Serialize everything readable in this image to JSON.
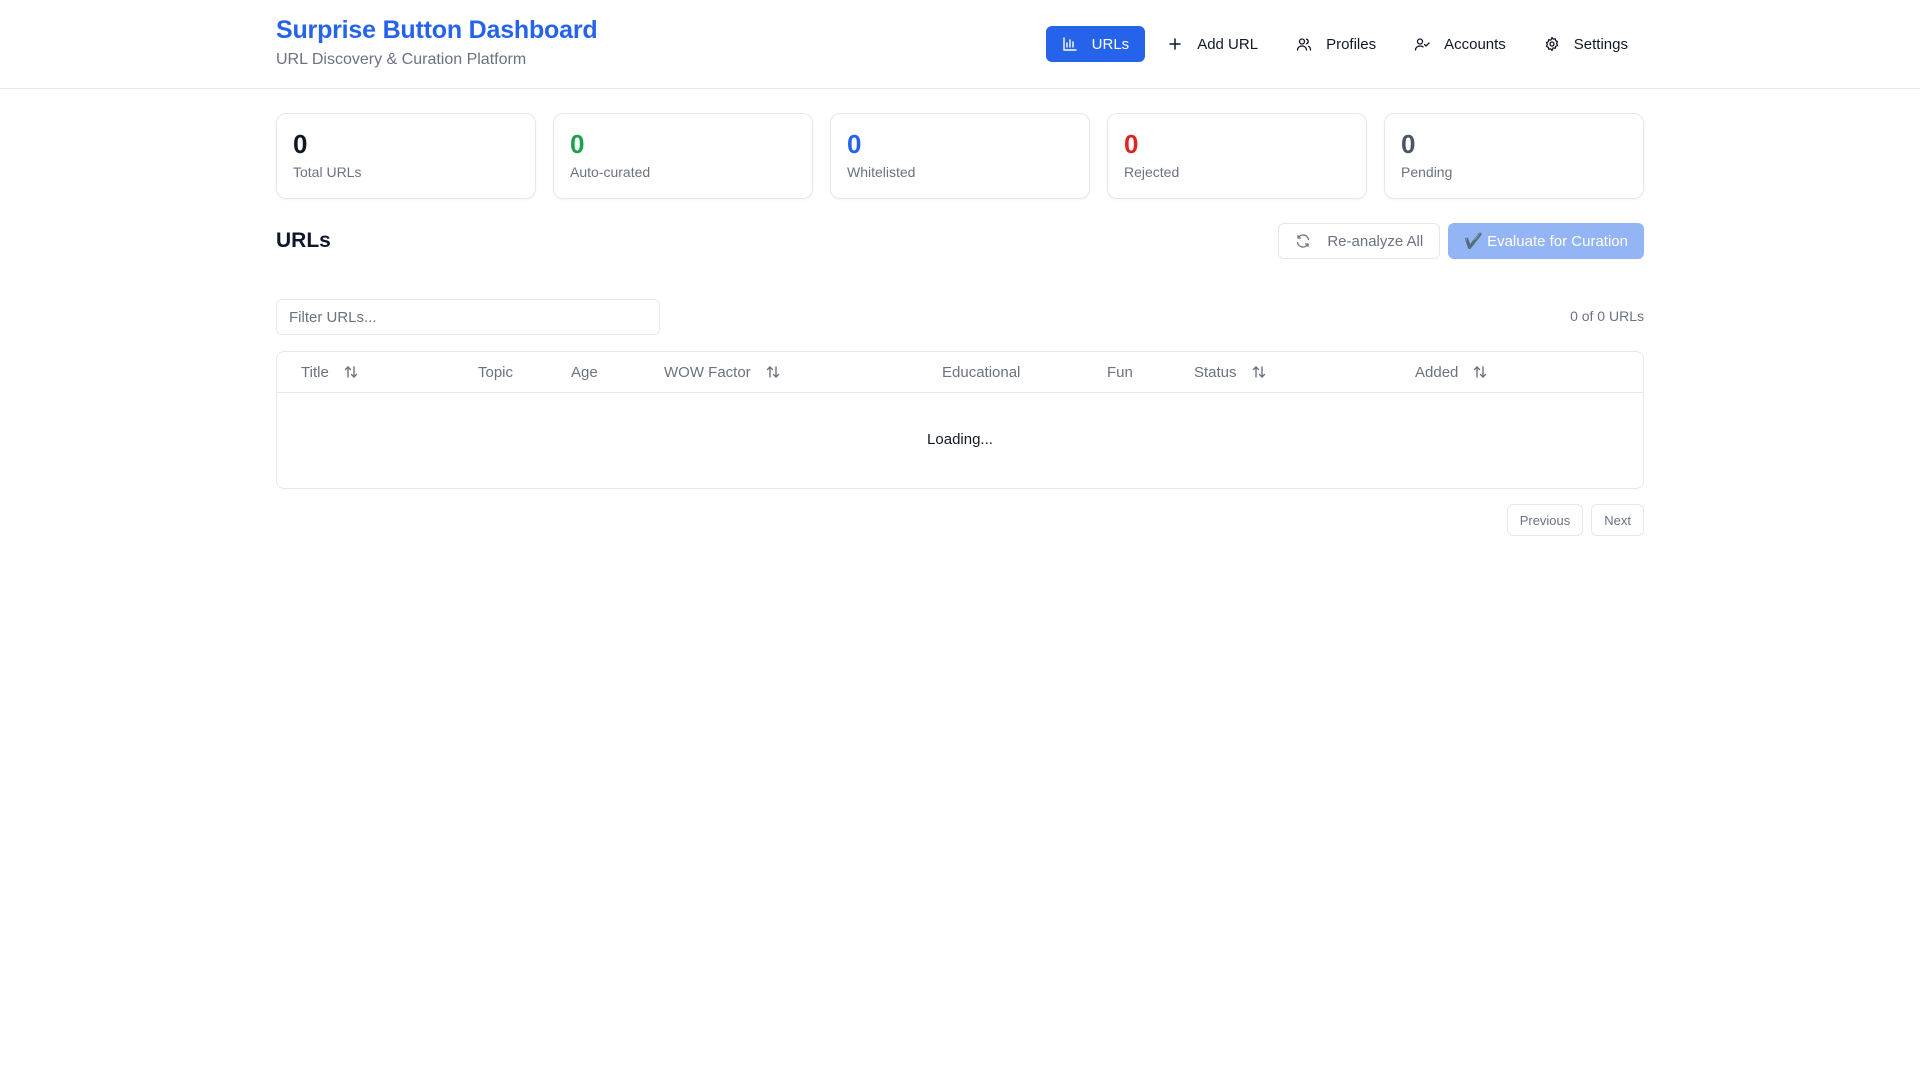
{
  "header": {
    "title": "Surprise Button Dashboard",
    "subtitle": "URL Discovery & Curation Platform",
    "nav": [
      {
        "label": "URLs",
        "icon": "bar-chart-icon",
        "active": true
      },
      {
        "label": "Add URL",
        "icon": "plus-icon",
        "active": false
      },
      {
        "label": "Profiles",
        "icon": "users-icon",
        "active": false
      },
      {
        "label": "Accounts",
        "icon": "user-check-icon",
        "active": false
      },
      {
        "label": "Settings",
        "icon": "gear-icon",
        "active": false
      }
    ]
  },
  "stats": [
    {
      "value": "0",
      "label": "Total URLs",
      "color": "#0f172a"
    },
    {
      "value": "0",
      "label": "Auto-curated",
      "color": "#16a34a"
    },
    {
      "value": "0",
      "label": "Whitelisted",
      "color": "#2563eb"
    },
    {
      "value": "0",
      "label": "Rejected",
      "color": "#dc2626"
    },
    {
      "value": "0",
      "label": "Pending",
      "color": "#4b5563"
    }
  ],
  "urls_section": {
    "title": "URLs",
    "reanalyze_label": "Re-analyze All",
    "evaluate_label": "✔️ Evaluate for Curation"
  },
  "filter": {
    "placeholder": "Filter URLs...",
    "value": "",
    "count_text": "0 of 0 URLs"
  },
  "table": {
    "columns": [
      {
        "label": "Title",
        "sortable": true
      },
      {
        "label": "Topic",
        "sortable": false
      },
      {
        "label": "Age",
        "sortable": false
      },
      {
        "label": "WOW Factor",
        "sortable": true
      },
      {
        "label": "Educational",
        "sortable": false
      },
      {
        "label": "Fun",
        "sortable": false
      },
      {
        "label": "Status",
        "sortable": true
      },
      {
        "label": "Added",
        "sortable": true
      }
    ],
    "loading_text": "Loading..."
  },
  "pagination": {
    "previous_label": "Previous",
    "next_label": "Next"
  },
  "colors": {
    "accent": "#2563eb",
    "accent_disabled": "#93b4f5"
  }
}
